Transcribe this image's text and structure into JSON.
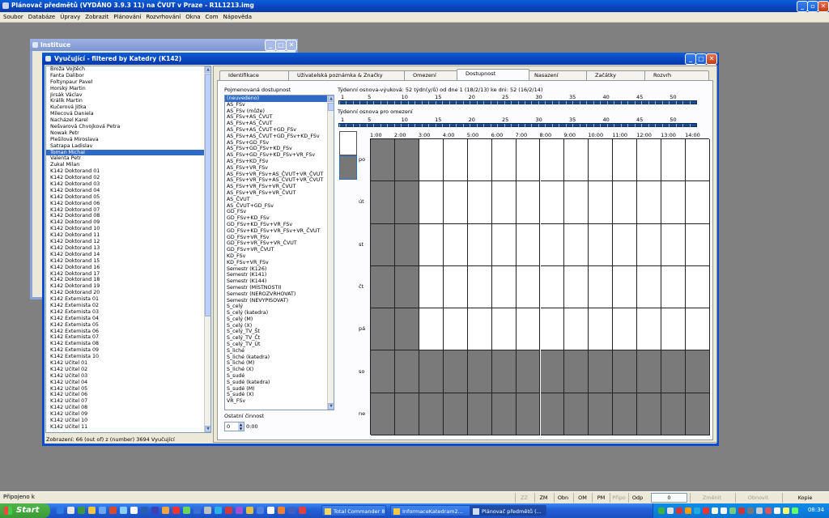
{
  "app": {
    "title": "Plánovač předmětů (VYDÁNO 3.9.3 11) na ČVUT v Praze - R1L1213.img",
    "menu": [
      "Soubor",
      "Databáze",
      "Úpravy",
      "Zobrazit",
      "Plánování",
      "Rozvrhování",
      "Okna",
      "Com",
      "Nápověda"
    ]
  },
  "instituce_window": {
    "title": "Instituce"
  },
  "vyucujici_window": {
    "title": "Vyučující - filtered by Katedry (K142)",
    "teachers": [
      "Broža Vojtěch",
      "Fanta Dalibor",
      "Foltynpaur Pavel",
      "Horský Martin",
      "Jirsák Václav",
      "Králík Martin",
      "Kučerová Jitka",
      "Milecová Daniela",
      "Nacházel Karel",
      "Nešvarová Chvojková Petra",
      "Nowak Petr",
      "Plešilová Miroslava",
      "Satrapa Ladislav",
      "Toman Michal",
      "Valenta Petr",
      "Zukal Milan",
      "K142 Doktorand 01",
      "K142 Doktorand 02",
      "K142 Doktorand 03",
      "K142 Doktorand 04",
      "K142 Doktorand 05",
      "K142 Doktorand 06",
      "K142 Doktorand 07",
      "K142 Doktorand 08",
      "K142 Doktorand 09",
      "K142 Doktorand 10",
      "K142 Doktorand 11",
      "K142 Doktorand 12",
      "K142 Doktorand 13",
      "K142 Doktorand 14",
      "K142 Doktorand 15",
      "K142 Doktorand 16",
      "K142 Doktorand 17",
      "K142 Doktorand 18",
      "K142 Doktorand 19",
      "K142 Doktorand 20",
      "K142 Externista 01",
      "K142 Externista 02",
      "K142 Externista 03",
      "K142 Externista 04",
      "K142 Externista 05",
      "K142 Externista 06",
      "K142 Externista 07",
      "K142 Externista 08",
      "K142 Externista 09",
      "K142 Externista 10",
      "K142 Učitel 01",
      "K142 Učitel 02",
      "K142 Učitel 03",
      "K142 Učitel 04",
      "K142 Učitel 05",
      "K142 Učitel 06",
      "K142 Učitel 07",
      "K142 Učitel 08",
      "K142 Učitel 09",
      "K142 Učitel 10",
      "K142 Učitel 11"
    ],
    "selected_teacher": "Toman Michal",
    "status": "Zobrazení: 66 (out of) z (number) 3694 Vyučující",
    "tabs": [
      "Identifikace",
      "Uživatelská poznámka & Značky",
      "Omezení",
      "Dostupnost",
      "Nasazení",
      "Začátky",
      "Rozvrh"
    ],
    "active_tab": "Dostupnost",
    "named_availability_label": "Pojmenovaná dostupnost",
    "availability_list": [
      "(neuvedeno)",
      "AS_FSv",
      "AS_FSv (může)",
      "AS_FSv+AS_ČVUT",
      "AS_FSv+AS_ČVUT",
      "AS_FSv+AS_ČVUT+GD_FSv",
      "AS_FSv+AS_ČVUT+GD_FSv+KD_FSv",
      "AS_FSv+GD_FSv",
      "AS_FSv+GD_FSv+KD_FSv",
      "AS_FSv+GD_FSv+KD_FSv+VR_FSv",
      "AS_FSv+KD_FSv",
      "AS_FSv+VR_FSv",
      "AS_FSv+VR_FSv+AS_ČVUT+VR_ČVUT",
      "AS_FSv+VR_FSv+AS_ČVUT+VR_ČVUT",
      "AS_FSv+VR_FSv+VR_ČVUT",
      "AS_FSv+VR_FSv+VR_ČVUT",
      "AS_ČVUT",
      "AS_ČVUT+GD_FSv",
      "GD_FSv",
      "GD_FSv+KD_FSv",
      "GD_FSv+KD_FSv+VR_FSv",
      "GD_FSv+KD_FSv+VR_FSv+VR_ČVUT",
      "GD_FSv+VR_FSv",
      "GD_FSv+VR_FSv+VR_ČVUT",
      "GD_FSv+VR_ČVUT",
      "KD_FSv",
      "KD_FSv+VR_FSv",
      "Semestr (K126)",
      "Semestr (K141)",
      "Semestr (K144)",
      "Semestr (MÍSTNOSTI)",
      "Semestr (NEROZVRHOVAT)",
      "Semestr (NEVYPISOVAT)",
      "S_celý",
      "S_celý (katedra)",
      "S_celý (M)",
      "S_celý (X)",
      "S_celý_TV_Št",
      "S_celý_TV_Čt",
      "S_celý_TV_Út",
      "S_liché",
      "S_liché (katedra)",
      "S_liché (M)",
      "S_liché (X)",
      "S_sudé",
      "S_sudé (katedra)",
      "S_sudé (M)",
      "S_sudé (X)",
      "VR_FSv"
    ],
    "other_activity_label": "Ostatní činnost",
    "other_activity_value": "0",
    "other_activity_time": "0:00",
    "weekly_outline_label": "Týdenní osnova-výuková: 52 týdn(y/ů) od dne 1 (18/2/13) ke dni: 52 (16/2/14)",
    "weekly_limit_label": "Týdenní osnova pro omezení",
    "week_scale": [
      "1",
      "5",
      "10",
      "15",
      "20",
      "25",
      "30",
      "35",
      "40",
      "45",
      "50"
    ],
    "hours": [
      "1:00",
      "2:00",
      "3:00",
      "4:00",
      "5:00",
      "6:00",
      "7:00",
      "8:00",
      "9:00",
      "10:00",
      "11:00",
      "12:00",
      "13:00",
      "14:00"
    ],
    "days": [
      "po",
      "út",
      "st",
      "čt",
      "pá",
      "so",
      "ne"
    ],
    "unavailable_note": "grey cells = unavailable; po–pá columns 1:00–2:00 and all of so, ne"
  },
  "status_bar": {
    "left": "Připojeno k",
    "buttons": [
      "ZZ",
      "ZM",
      "Obn",
      "OM",
      "PM",
      "Připo",
      "Odp"
    ],
    "disabled_buttons": [
      "ZZ",
      "Připo"
    ],
    "counter": "0",
    "right_buttons": [
      "Změnit",
      "Obnovit",
      "Kopie"
    ],
    "disabled_right": [
      "Změnit",
      "Obnovit"
    ]
  },
  "taskbar": {
    "start": "Start",
    "tasks": [
      "Total Commander 8.0...",
      "InformaceKatedram2...",
      "Plánovač předmětů (..."
    ],
    "active_task": 2,
    "clock": "08:34"
  }
}
